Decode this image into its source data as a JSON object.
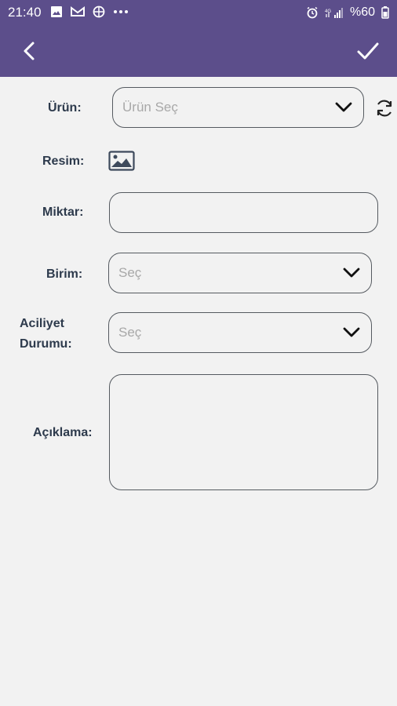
{
  "status_bar": {
    "time": "21:40",
    "battery": "%60",
    "left_icons": [
      "gallery-icon",
      "mail-icon",
      "vpn-icon",
      "more-dots-icon"
    ],
    "right_icons": [
      "alarm-icon",
      "signal-icon",
      "battery-icon"
    ],
    "background_color": "#5c4e8b"
  },
  "app_bar": {
    "back_icon": "chevron-left-icon",
    "save_icon": "check-icon",
    "background_color": "#5c4e8b"
  },
  "form": {
    "product": {
      "label": "Ürün:",
      "placeholder": "Ürün Seç",
      "value": ""
    },
    "image": {
      "label": "Resim:"
    },
    "quantity": {
      "label": "Miktar:",
      "value": ""
    },
    "unit": {
      "label": "Birim:",
      "placeholder": "Seç",
      "value": ""
    },
    "urgency": {
      "label_line1": "Aciliyet",
      "label_line2": "Durumu:",
      "placeholder": "Seç",
      "value": ""
    },
    "description": {
      "label": "Açıklama:",
      "value": ""
    }
  }
}
